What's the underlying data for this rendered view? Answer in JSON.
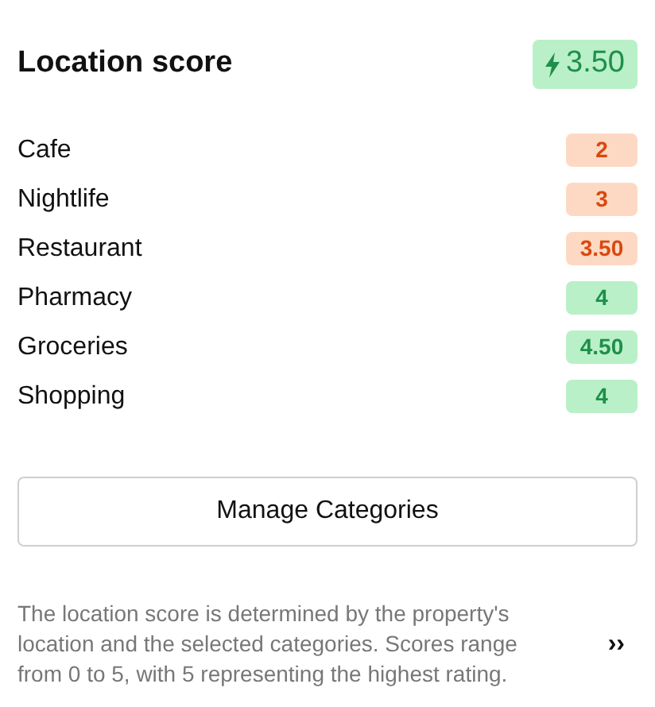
{
  "header": {
    "title": "Location score",
    "score": "3.50",
    "color": "#b9f0c8"
  },
  "categories": [
    {
      "name": "Cafe",
      "score": "2",
      "color": "#fdd9c4"
    },
    {
      "name": "Nightlife",
      "score": "3",
      "color": "#fdd9c4"
    },
    {
      "name": "Restaurant",
      "score": "3.50",
      "color": "#fdd9c4"
    },
    {
      "name": "Pharmacy",
      "score": "4",
      "color": "#b9f0c8"
    },
    {
      "name": "Groceries",
      "score": "4.50",
      "color": "#b9f0c8"
    },
    {
      "name": "Shopping",
      "score": "4",
      "color": "#b9f0c8"
    }
  ],
  "button": "Manage Categories",
  "note": "The location score is determined by the property's location and the selected categories. Scores range from 0 to 5, with 5 representing the highest rating.",
  "expand": "››"
}
